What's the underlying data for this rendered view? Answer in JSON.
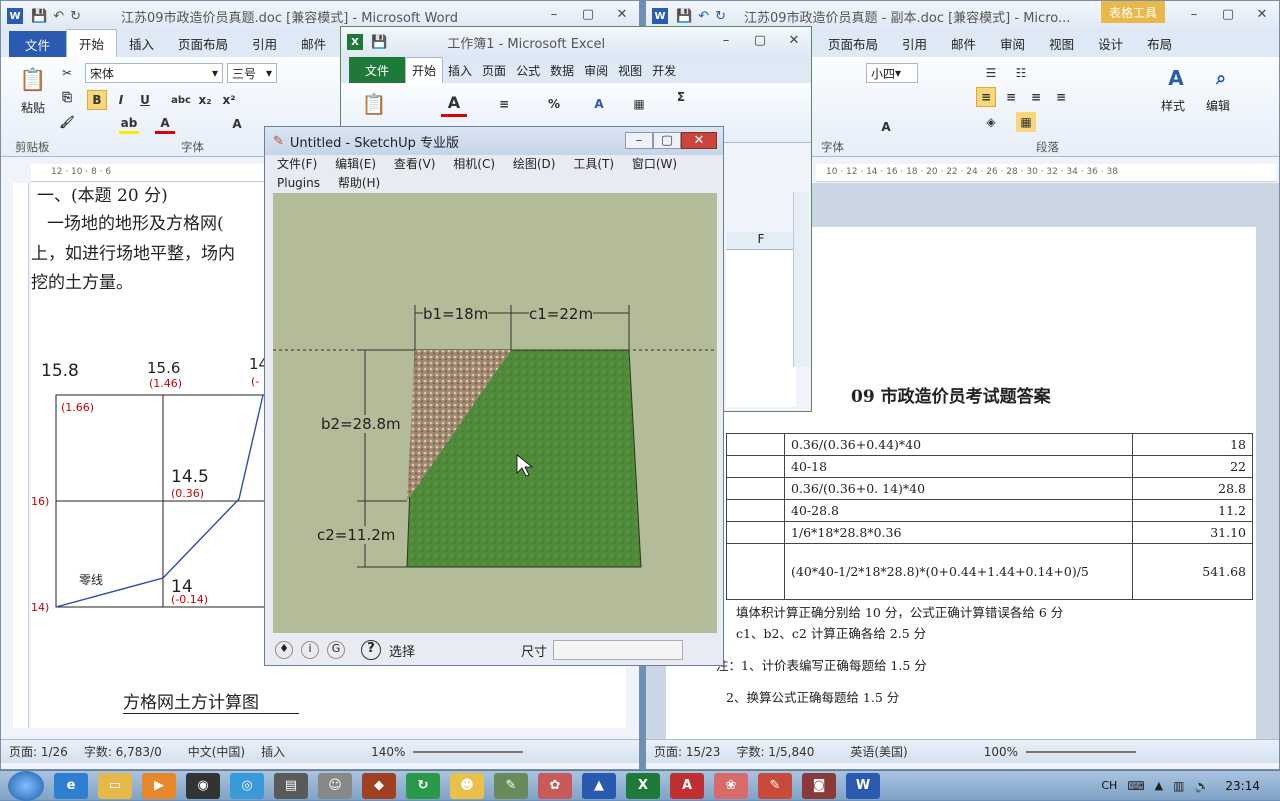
{
  "word_left": {
    "title": "江苏09市政造价员真题.doc [兼容模式] - Microsoft Word",
    "tabs": [
      "文件",
      "开始",
      "插入",
      "页面布局",
      "引用",
      "邮件"
    ],
    "font_name": "宋体",
    "font_size": "三号",
    "paste_label": "粘贴",
    "groups": {
      "clipboard": "剪贴板",
      "font": "字体"
    },
    "doc": {
      "heading": "一、(本题 20 分)",
      "line1": "一场地的地形及方格网(",
      "line2": "上，如进行场地平整，场内",
      "line3": "挖的土方量。",
      "grid_values": {
        "v1": "15.8",
        "v2": "15.6",
        "v2b": "(1.46)",
        "v3": "14",
        "v3b": "(-",
        "v4": "(1.66)",
        "v5": "14.5",
        "v5b": "(0.36)",
        "v6": "16)",
        "v7": "零线",
        "v8": "14",
        "v8b": "(-0.14)",
        "v9": "14)"
      },
      "caption": "方格网土方计算图"
    },
    "status": {
      "page": "页面: 1/26",
      "words": "字数: 6,783/0",
      "lang": "中文(中国)",
      "mode": "插入",
      "zoom": "140%"
    }
  },
  "word_right": {
    "title": "江苏09市政造价员真题 - 副本.doc [兼容模式] - Micro...",
    "context_tab": "表格工具",
    "tabs": [
      "页面布局",
      "引用",
      "邮件",
      "审阅",
      "视图",
      "设计",
      "布局"
    ],
    "font_size": "小四",
    "groups": {
      "font": "字体",
      "paragraph": "段落",
      "styles": "样式",
      "edit": "编辑"
    },
    "doc": {
      "answer_title": "09 市政造价员考试题答案",
      "rows": [
        {
          "formula": "0.36/(0.36+0.44)*40",
          "value": "18"
        },
        {
          "formula": "40-18",
          "value": "22"
        },
        {
          "formula": "0.36/(0.36+0. 14)*40",
          "value": "28.8"
        },
        {
          "formula": "40-28.8",
          "value": "11.2"
        },
        {
          "formula": "1/6*18*28.8*0.36",
          "value": "31.10"
        },
        {
          "formula": "(40*40-1/2*18*28.8)*(0+0.44+1.44+0.14+0)/5",
          "value": "541.68"
        }
      ],
      "note1": "填体积计算正确分别给 10 分，公式正确计算错误各给 6 分",
      "note2": "c1、b2、c2 计算正确各给 2.5 分",
      "note3": "注：1、计价表编写正确每题给 1.5 分",
      "note4": "2、换算公式正确每题给 1.5 分"
    },
    "status": {
      "page": "页面: 15/23",
      "words": "字数: 1/5,840",
      "lang": "英语(美国)",
      "zoom": "100%"
    }
  },
  "excel": {
    "title": "工作簿1 - Microsoft Excel",
    "tabs": [
      "文件",
      "开始",
      "插入",
      "页面",
      "公式",
      "数据",
      "审阅",
      "视图",
      "开发"
    ],
    "col_f": "F"
  },
  "sketchup": {
    "title": "Untitled - SketchUp 专业版",
    "menu": [
      "文件(F)",
      "编辑(E)",
      "查看(V)",
      "相机(C)",
      "绘图(D)",
      "工具(T)",
      "窗口(W)",
      "Plugins",
      "帮助(H)"
    ],
    "dims": {
      "b1": "b1=18m",
      "c1": "c1=22m",
      "b2": "b2=28.8m",
      "c2": "c2=11.2m"
    },
    "status_tool": "选择",
    "measure_label": "尺寸"
  },
  "taskbar": {
    "ime": "CH",
    "time": "23:14"
  },
  "colors": {
    "word_blue": "#2a5bb0",
    "excel_green": "#1f7a3a",
    "grass": "#4f8a3a",
    "gravel": "#a08870",
    "su_bg": "#b4bb98"
  }
}
